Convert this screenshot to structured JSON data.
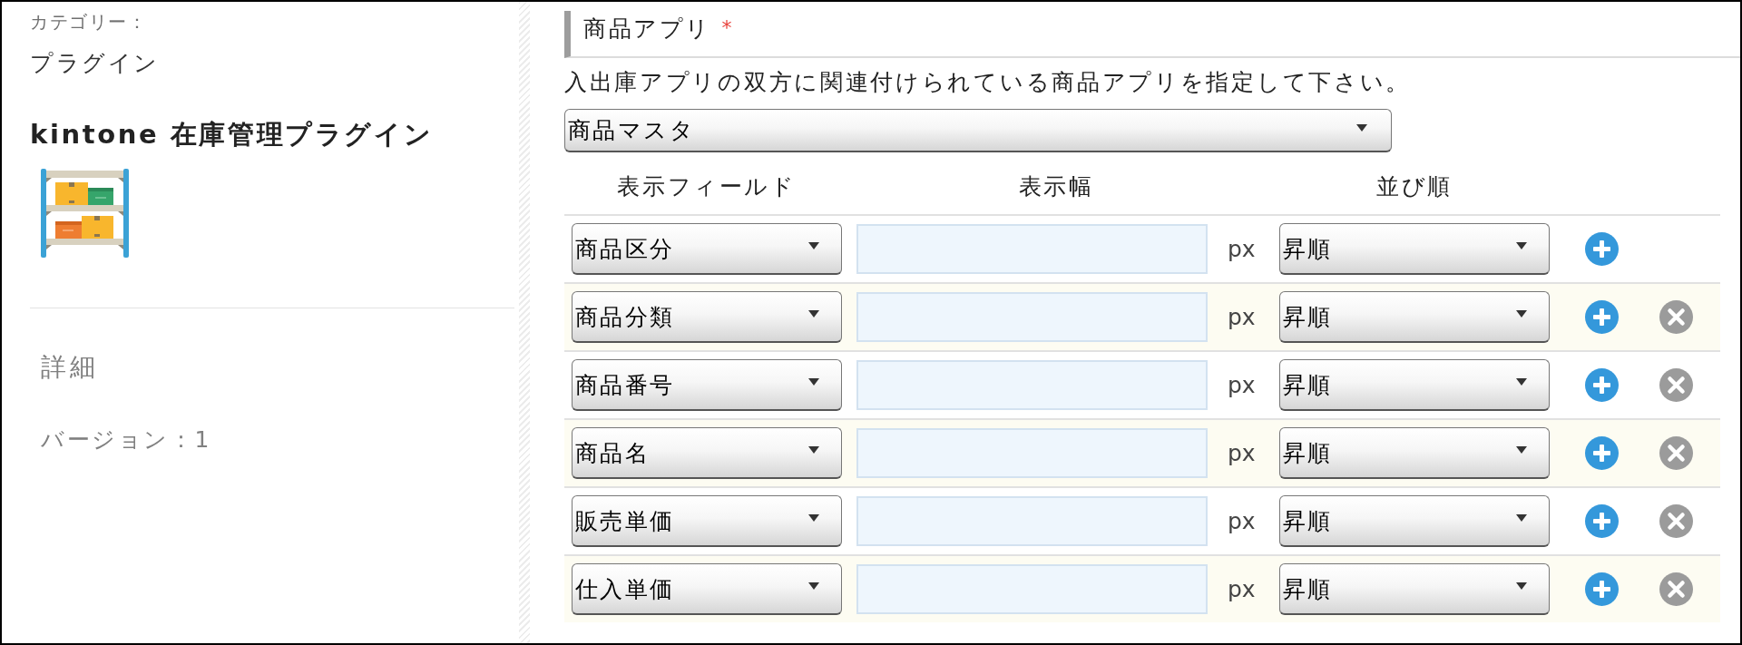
{
  "plugin": {
    "category_label": "カテゴリー：",
    "category": "プラグイン",
    "name": "kintone 在庫管理プラグイン",
    "details_heading": "詳細",
    "version": "バージョン：1"
  },
  "product_app": {
    "label": "商品アプリ",
    "required_mark": "*",
    "description": "入出庫アプリの双方に関連付けられている商品アプリを指定して下さい。",
    "app_select": "商品マスタ"
  },
  "display_fields": {
    "columns": [
      "表示フィールド",
      "表示幅",
      "並び順"
    ],
    "rows": [
      {
        "field": "商品区分",
        "unit": "px",
        "sort": "昇順",
        "removable": false
      },
      {
        "field": "商品分類",
        "unit": "px",
        "sort": "昇順",
        "removable": true
      },
      {
        "field": "商品番号",
        "unit": "px",
        "sort": "昇順",
        "removable": true
      },
      {
        "field": "商品名",
        "unit": "px",
        "sort": "昇順",
        "removable": true
      },
      {
        "field": "販売単価",
        "unit": "px",
        "sort": "昇順",
        "removable": true
      },
      {
        "field": "仕入単価",
        "unit": "px",
        "sort": "昇順",
        "removable": true
      }
    ]
  }
}
